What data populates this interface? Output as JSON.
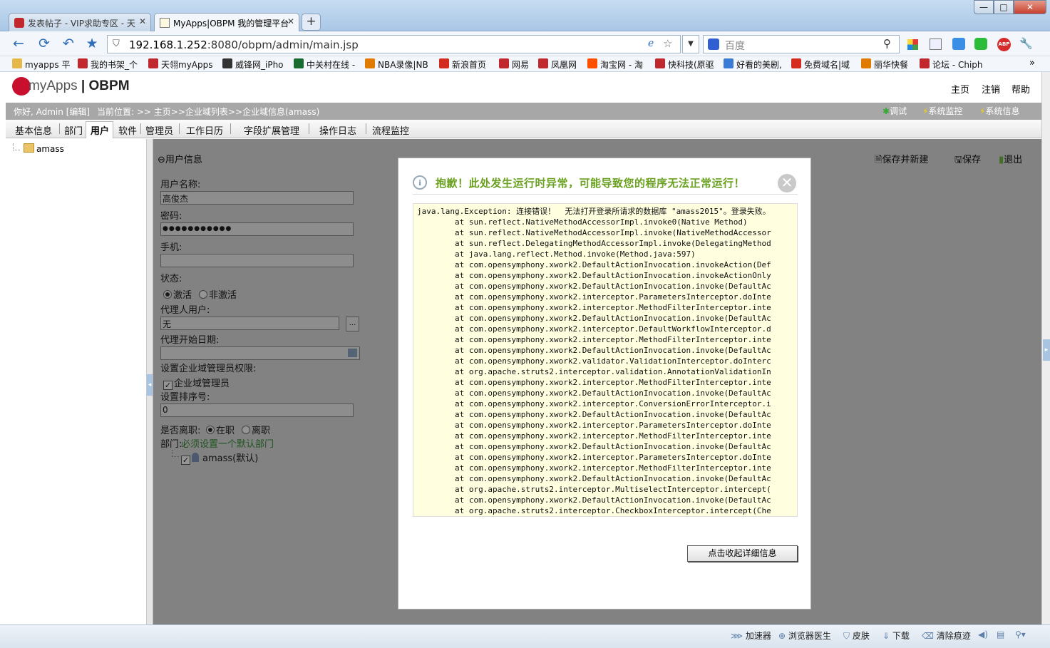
{
  "browser": {
    "tabs": [
      {
        "label": "发表帖子 - VIP求助专区 - 天",
        "close": "✕"
      },
      {
        "label": "MyApps|OBPM 我的管理平台",
        "close": "✕"
      }
    ],
    "new_tab": "+",
    "window_buttons": {
      "minimize": "—",
      "maximize": "□",
      "close": "✕"
    },
    "url_host": "192.168.1.252",
    "url_rest": ":8080/obpm/admin/main.jsp",
    "search_engine": "百度",
    "bookmarks": [
      {
        "label": "myapps 平",
        "color": "#e6b84a"
      },
      {
        "label": "我的书架_个",
        "color": "#c0282d"
      },
      {
        "label": "天翎myApps",
        "color": "#c0282d"
      },
      {
        "label": "威锋网_iPho",
        "color": "#333333"
      },
      {
        "label": "中关村在线 -",
        "color": "#1a6b2f"
      },
      {
        "label": "NBA录像|NB",
        "color": "#e07b00"
      },
      {
        "label": "新浪首页",
        "color": "#d52b1e"
      },
      {
        "label": "网易",
        "color": "#c0282d"
      },
      {
        "label": "凤凰网",
        "color": "#c0282d"
      },
      {
        "label": "淘宝网 - 淘",
        "color": "#ff5000"
      },
      {
        "label": "快科技(原驱",
        "color": "#c0282d"
      },
      {
        "label": "好看的美剧,",
        "color": "#3a7bd5"
      },
      {
        "label": "免费域名|域",
        "color": "#d52b1e"
      },
      {
        "label": "丽华快餐",
        "color": "#e07b00"
      },
      {
        "label": "论坛 - Chiph",
        "color": "#c0282d"
      }
    ],
    "bookmarks_more": "»"
  },
  "app": {
    "logo_text": "myApps",
    "logo_suffix": "OBPM",
    "top_nav": [
      "主页",
      "注销",
      "帮助"
    ],
    "greeting": "你好, Admin [编辑]",
    "location": "当前位置: >> 主页>>企业域列表>>企业域信息(amass)",
    "tools": [
      "调试",
      "系统监控",
      "系统信息"
    ],
    "menu": [
      "基本信息",
      "部门",
      "用户",
      "软件",
      "管理员",
      "工作日历",
      "字段扩展管理",
      "操作日志",
      "流程监控"
    ],
    "active_menu": "用户",
    "tree_root": "amass"
  },
  "form": {
    "section_title": "用户信息",
    "actions": [
      "保存并新建",
      "保存",
      "退出"
    ],
    "username_label": "用户名称:",
    "username_value": "高俊杰",
    "password_label": "密码:",
    "password_value": "●●●●●●●●●●●",
    "phone_label": "手机:",
    "phone_value": "",
    "status_label": "状态:",
    "status_active": "激活",
    "status_inactive": "非激活",
    "proxy_label": "代理人用户:",
    "proxy_value": "无",
    "proxy_btn": "...",
    "proxy_start_label": "代理开始日期:",
    "domain_admin_label": "设置企业域管理员权限:",
    "domain_admin_checkbox": "企业域管理员",
    "sort_label": "设置排序号:",
    "sort_value": "0",
    "resign_label": "是否离职:",
    "resign_on": "在职",
    "resign_off": "离职",
    "dept_label": "部门:",
    "dept_hint": "必须设置一个默认部门",
    "dept_item": "amass(默认)"
  },
  "dialog": {
    "title": "抱歉！此处发生运行时异常，可能导致您的程序无法正常运行！",
    "close": "✕",
    "trace": [
      "java.lang.Exception: 连接错误！  无法打开登录所请求的数据库 \"amass2015\"。登录失败。",
      "        at sun.reflect.NativeMethodAccessorImpl.invoke0(Native Method)",
      "        at sun.reflect.NativeMethodAccessorImpl.invoke(NativeMethodAccessor",
      "        at sun.reflect.DelegatingMethodAccessorImpl.invoke(DelegatingMethod",
      "        at java.lang.reflect.Method.invoke(Method.java:597)",
      "        at com.opensymphony.xwork2.DefaultActionInvocation.invokeAction(Def",
      "        at com.opensymphony.xwork2.DefaultActionInvocation.invokeActionOnly",
      "        at com.opensymphony.xwork2.DefaultActionInvocation.invoke(DefaultAc",
      "        at com.opensymphony.xwork2.interceptor.ParametersInterceptor.doInte",
      "        at com.opensymphony.xwork2.interceptor.MethodFilterInterceptor.inte",
      "        at com.opensymphony.xwork2.DefaultActionInvocation.invoke(DefaultAc",
      "        at com.opensymphony.xwork2.interceptor.DefaultWorkflowInterceptor.d",
      "        at com.opensymphony.xwork2.interceptor.MethodFilterInterceptor.inte",
      "        at com.opensymphony.xwork2.DefaultActionInvocation.invoke(DefaultAc",
      "        at com.opensymphony.xwork2.validator.ValidationInterceptor.doInterc",
      "        at org.apache.struts2.interceptor.validation.AnnotationValidationIn",
      "        at com.opensymphony.xwork2.interceptor.MethodFilterInterceptor.inte",
      "        at com.opensymphony.xwork2.DefaultActionInvocation.invoke(DefaultAc",
      "        at com.opensymphony.xwork2.interceptor.ConversionErrorInterceptor.i",
      "        at com.opensymphony.xwork2.DefaultActionInvocation.invoke(DefaultAc",
      "        at com.opensymphony.xwork2.interceptor.ParametersInterceptor.doInte",
      "        at com.opensymphony.xwork2.interceptor.MethodFilterInterceptor.inte",
      "        at com.opensymphony.xwork2.DefaultActionInvocation.invoke(DefaultAc",
      "        at com.opensymphony.xwork2.interceptor.ParametersInterceptor.doInte",
      "        at com.opensymphony.xwork2.interceptor.MethodFilterInterceptor.inte",
      "        at com.opensymphony.xwork2.DefaultActionInvocation.invoke(DefaultAc",
      "        at org.apache.struts2.interceptor.MultiselectInterceptor.intercept(",
      "        at com.opensymphony.xwork2.DefaultActionInvocation.invoke(DefaultAc",
      "        at org.apache.struts2.interceptor.CheckboxInterceptor.intercept(Che"
    ],
    "toggle_button": "点击收起详细信息"
  },
  "statusbar": [
    "加速器",
    "浏览器医生",
    "皮肤",
    "下载",
    "清除痕迹"
  ],
  "colors": {
    "dialog_title": "#6aa121",
    "trace_bg": "#ffffe0",
    "bread_bar": "#a7a7a7",
    "dept_hint": "#2e8b2e"
  }
}
